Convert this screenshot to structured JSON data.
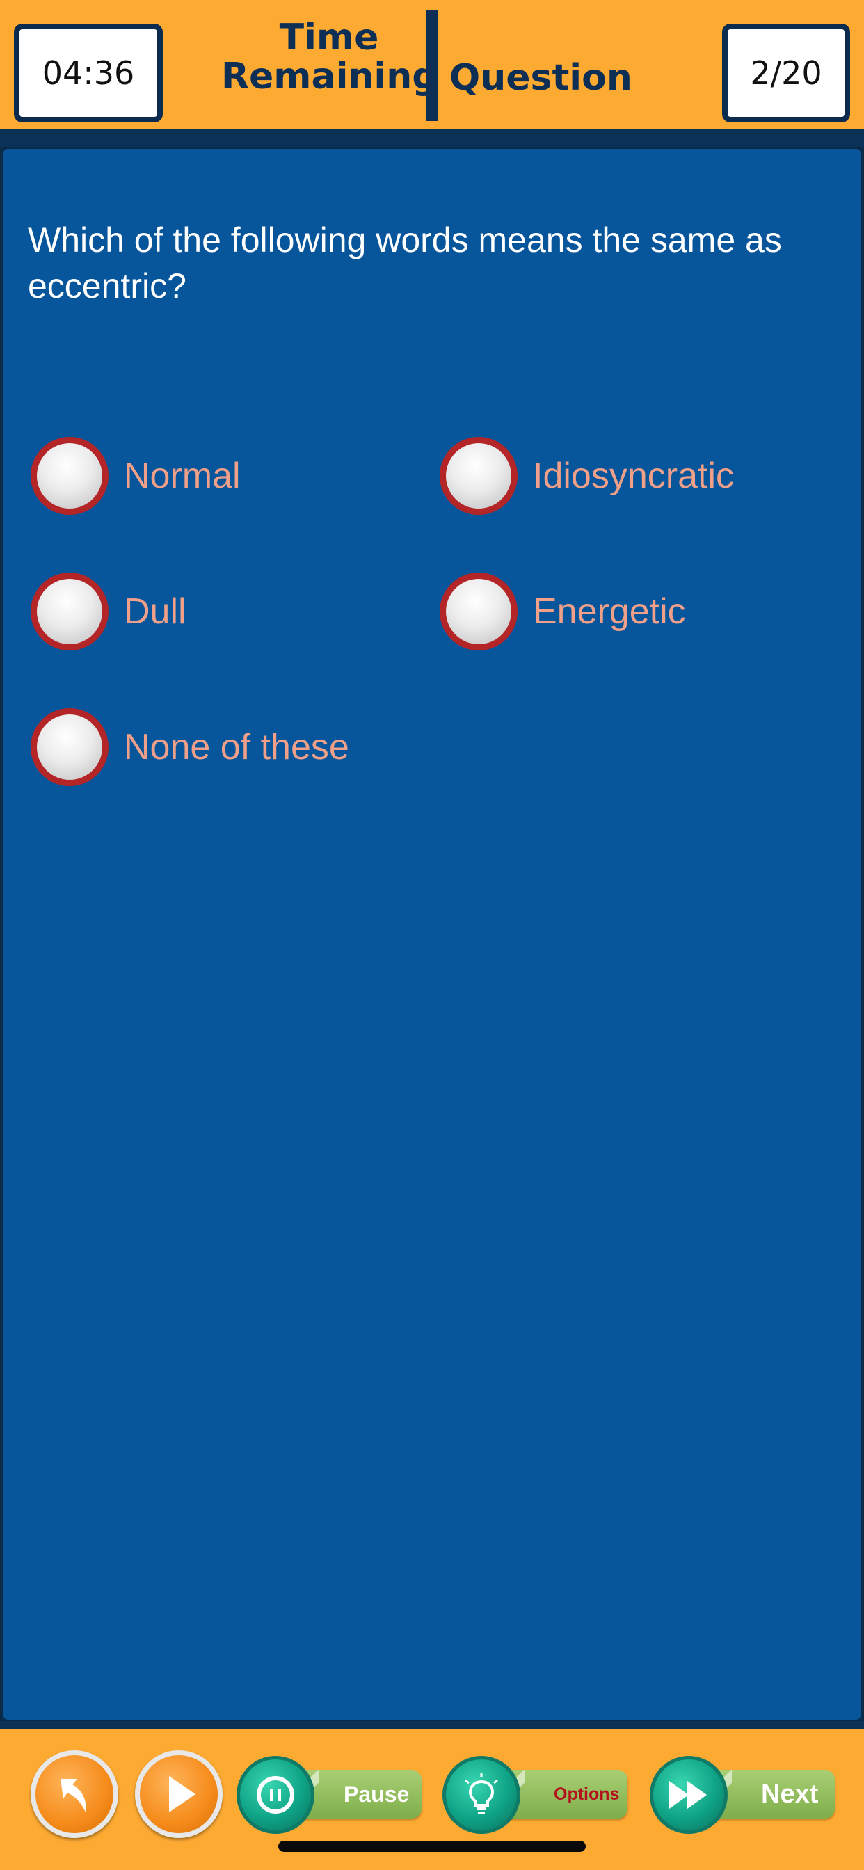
{
  "header": {
    "timer_value": "04:36",
    "time_label_line1": "Time",
    "time_label_line2": "Remaining",
    "question_label": "Question",
    "question_counter": "2/20"
  },
  "quiz": {
    "question": "Which of the following words means the same as eccentric?",
    "options": [
      {
        "label": "Normal"
      },
      {
        "label": "Idiosyncratic"
      },
      {
        "label": "Dull"
      },
      {
        "label": "Energetic"
      },
      {
        "label": "None of these"
      }
    ]
  },
  "toolbar": {
    "back_icon": "back-arrow-icon",
    "play_icon": "play-icon",
    "pause_label": "Pause",
    "pause_icon": "pause-icon",
    "options_label": "Options",
    "options_icon": "lightbulb-icon",
    "next_label": "Next",
    "next_icon": "fast-forward-icon"
  },
  "colors": {
    "header_bg": "#fdaa33",
    "panel_bg": "#07559b",
    "dark_navy": "#0d2f55",
    "option_text": "#f0a088",
    "radio_ring": "#b32526",
    "teal_button": "#0fa386",
    "green_pill": "#8fbd5a"
  }
}
